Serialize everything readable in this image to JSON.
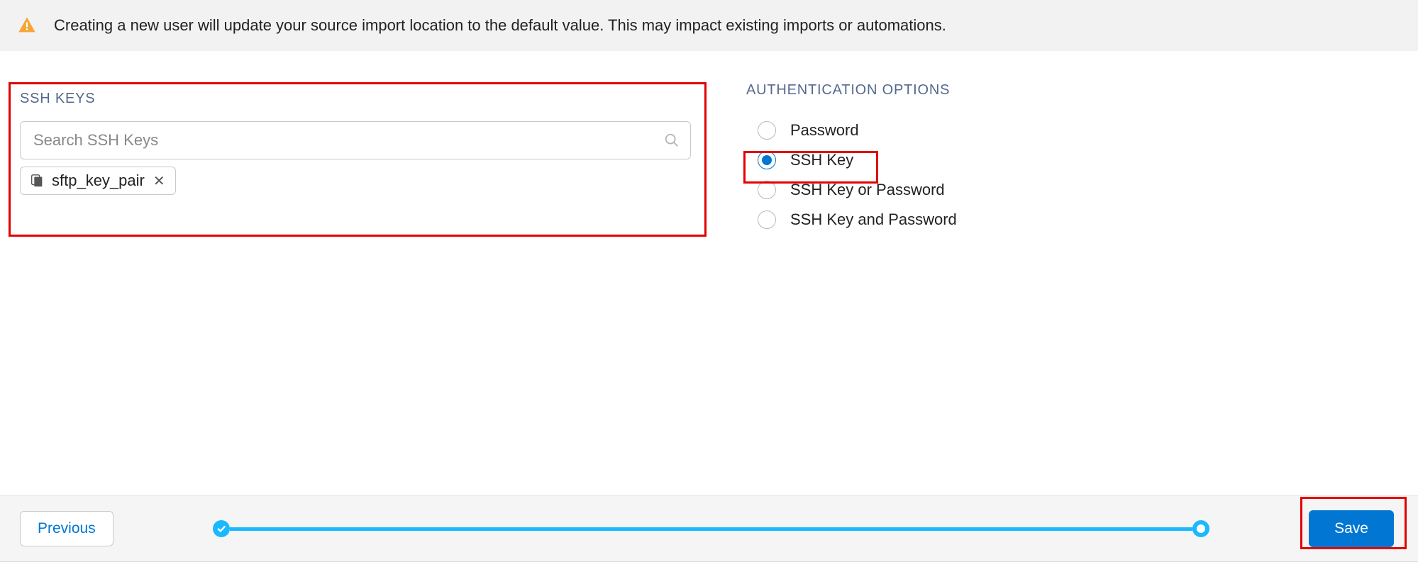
{
  "alert": {
    "text": "Creating a new user will update your source import location to the default value. This may impact existing imports or automations."
  },
  "ssh": {
    "section_label": "SSH KEYS",
    "search_placeholder": "Search SSH Keys",
    "chip_label": "sftp_key_pair"
  },
  "auth": {
    "section_label": "AUTHENTICATION OPTIONS",
    "options": [
      {
        "label": "Password",
        "selected": false
      },
      {
        "label": "SSH Key",
        "selected": true
      },
      {
        "label": "SSH Key or Password",
        "selected": false
      },
      {
        "label": "SSH Key and Password",
        "selected": false
      }
    ]
  },
  "footer": {
    "previous_label": "Previous",
    "save_label": "Save"
  }
}
